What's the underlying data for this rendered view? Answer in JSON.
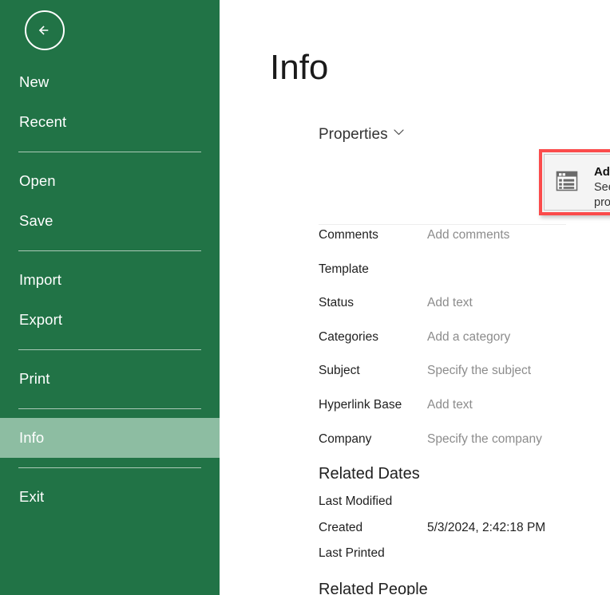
{
  "sidebar": {
    "back_button": "back-arrow-icon",
    "items": [
      {
        "label": "New",
        "type": "item",
        "active": false
      },
      {
        "label": "Recent",
        "type": "item",
        "active": false
      },
      {
        "label": "",
        "type": "separator",
        "active": false
      },
      {
        "label": "Open",
        "type": "item",
        "active": false
      },
      {
        "label": "Save",
        "type": "item",
        "active": false
      },
      {
        "label": "",
        "type": "separator",
        "active": false
      },
      {
        "label": "Import",
        "type": "item",
        "active": false
      },
      {
        "label": "Export",
        "type": "item",
        "active": false
      },
      {
        "label": "",
        "type": "separator",
        "active": false
      },
      {
        "label": "Print",
        "type": "item",
        "active": false
      },
      {
        "label": "",
        "type": "separator",
        "active": false
      },
      {
        "label": "Info",
        "type": "item",
        "active": true
      },
      {
        "label": "",
        "type": "separator",
        "active": false
      },
      {
        "label": "Exit",
        "type": "item",
        "active": false
      }
    ]
  },
  "main": {
    "page_title": "Info",
    "properties_header": "Properties",
    "dropdown": {
      "title": "Advanced Properties",
      "subtitle": "See more document properties",
      "icon": "document-properties-icon"
    },
    "properties": [
      {
        "label": "Comments",
        "value": "Add comments",
        "filled": false
      },
      {
        "label": "Template",
        "value": "",
        "filled": false
      },
      {
        "label": "Status",
        "value": "Add text",
        "filled": false
      },
      {
        "label": "Categories",
        "value": "Add a category",
        "filled": false
      },
      {
        "label": "Subject",
        "value": "Specify the subject",
        "filled": false
      },
      {
        "label": "Hyperlink Base",
        "value": "Add text",
        "filled": false
      },
      {
        "label": "Company",
        "value": "Specify the company",
        "filled": false
      }
    ],
    "related_dates_header": "Related Dates",
    "related_dates": [
      {
        "label": "Last Modified",
        "value": "",
        "filled": false
      },
      {
        "label": "Created",
        "value": "5/3/2024, 2:42:18 PM",
        "filled": true
      },
      {
        "label": "Last Printed",
        "value": "",
        "filled": false
      }
    ],
    "related_people_header": "Related People"
  },
  "colors": {
    "sidebar_green": "#217346",
    "sidebar_active": "#8dbda2",
    "highlight_red": "#fb4b4b",
    "placeholder_gray": "#8c8c8c",
    "text_dark": "#1f1f1f"
  }
}
